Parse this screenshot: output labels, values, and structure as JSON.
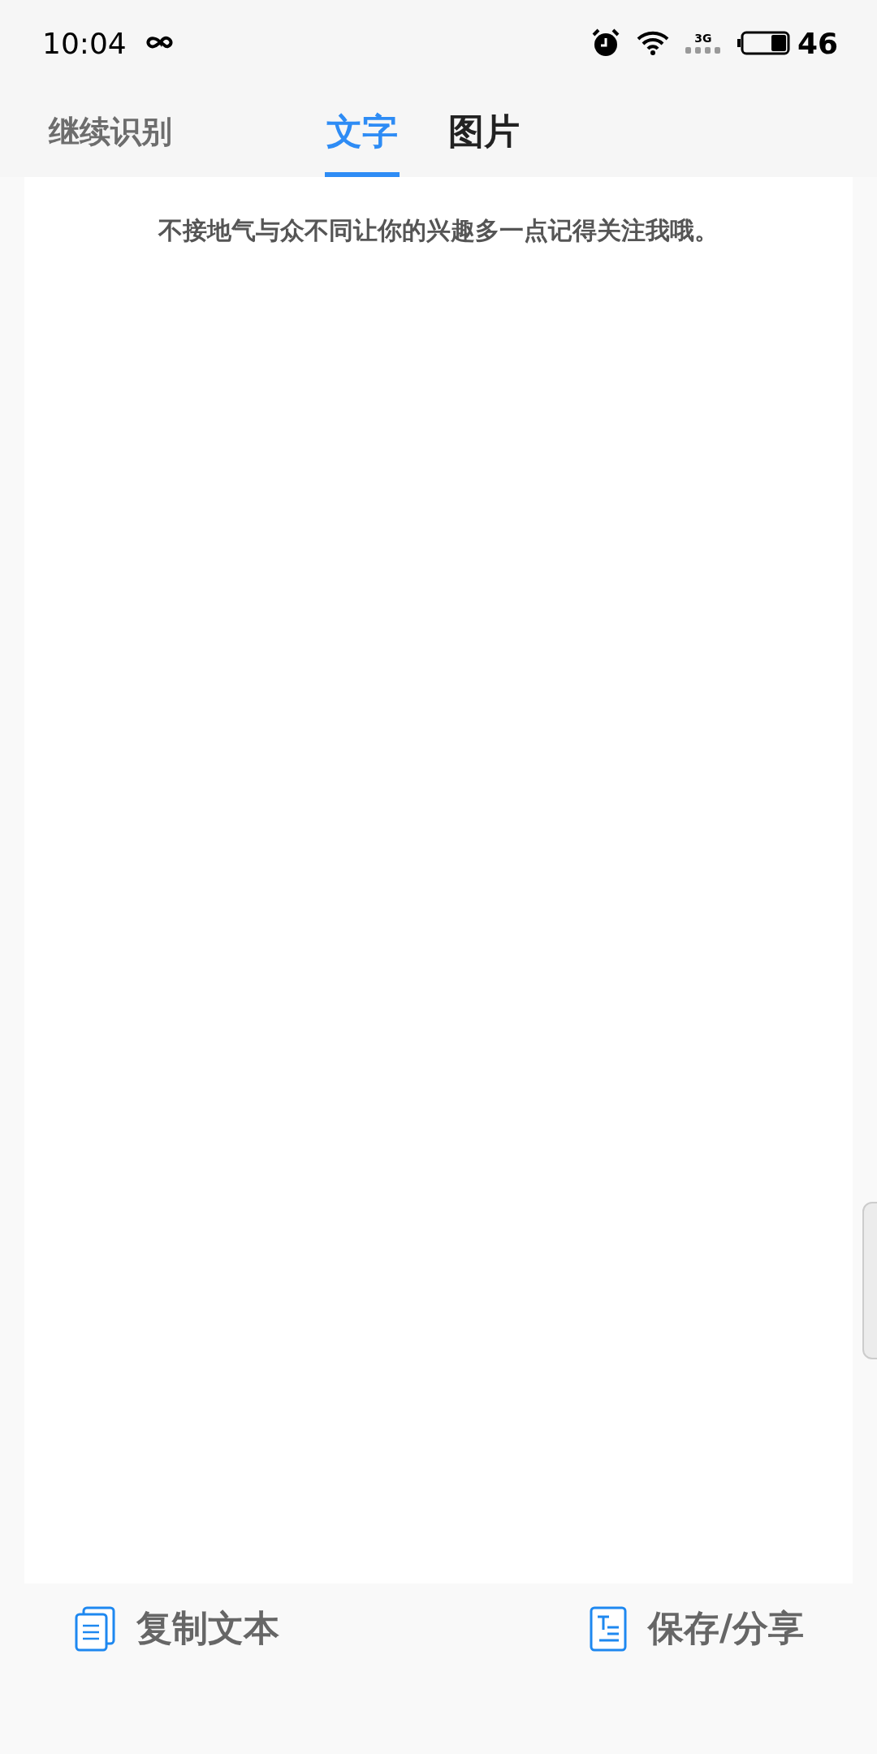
{
  "status_bar": {
    "time": "10:04",
    "network": "3G",
    "battery": "46"
  },
  "header": {
    "back_label": "继续识别"
  },
  "tabs": [
    {
      "label": "文字",
      "selected": true
    },
    {
      "label": "图片",
      "selected": false
    }
  ],
  "content": {
    "text": "不接地气与众不同让你的兴趣多一点记得关注我哦。"
  },
  "actions": [
    {
      "kind": "copy",
      "label": "复制文本"
    },
    {
      "kind": "save",
      "label": "保存/分享"
    }
  ]
}
